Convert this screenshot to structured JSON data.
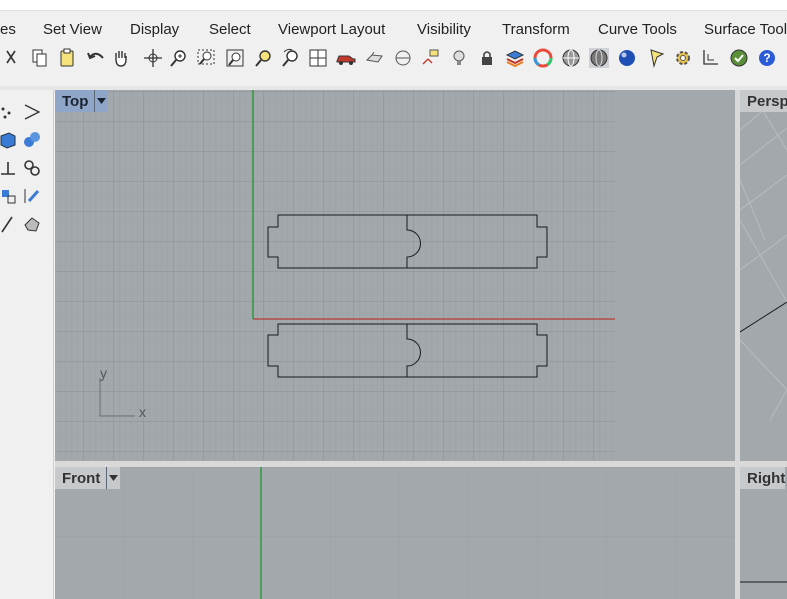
{
  "menubar": {
    "items": [
      {
        "label": "es"
      },
      {
        "label": "Set View"
      },
      {
        "label": "Display"
      },
      {
        "label": "Select"
      },
      {
        "label": "Viewport Layout"
      },
      {
        "label": "Visibility"
      },
      {
        "label": "Transform"
      },
      {
        "label": "Curve Tools"
      },
      {
        "label": "Surface Tools"
      }
    ]
  },
  "toolbar": {
    "icons": [
      "cut-icon",
      "copy-icon",
      "paste-icon",
      "undo-icon",
      "pan-hand-icon",
      "rotate-view-icon",
      "zoom-icon",
      "zoom-window-icon",
      "zoom-extents-icon",
      "zoom-selected-icon",
      "undo-view-icon",
      "four-viewports-icon",
      "car-icon",
      "named-views-icon",
      "clipping-plane-icon",
      "cplane-icon",
      "light-bulb-icon",
      "lock-icon",
      "layers-icon",
      "color-wheel-icon",
      "wireframe-sphere-icon",
      "shaded-sphere-icon",
      "rendered-sphere-icon",
      "select-filter-icon",
      "options-gear-icon",
      "dimension-icon",
      "render-icon",
      "help-icon"
    ]
  },
  "palette": {
    "icons": [
      "point-cloud-icon",
      "polyline-icon",
      "box-icon",
      "spheres-icon",
      "move-icon",
      "group-icon",
      "transform-icon",
      "edit-points-icon",
      "line-icon",
      "solid-icon"
    ]
  },
  "viewports": {
    "top": {
      "label": "Top",
      "axis_x": "x",
      "axis_y": "y"
    },
    "front": {
      "label": "Front"
    },
    "perspective": {
      "label": "Persp"
    },
    "right": {
      "label": "Right"
    }
  },
  "colors": {
    "viewport_bg": "#a3a8ad",
    "grid_minor": "#9a9fa4",
    "grid_major": "#8d9297",
    "x_axis": "#b24a4a",
    "y_axis": "#2e9a3a",
    "active_tab": "#8fa6c9",
    "curve": "#1a1a1a"
  }
}
